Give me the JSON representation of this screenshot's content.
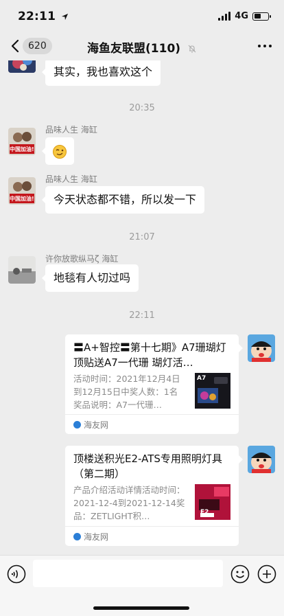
{
  "status": {
    "time": "22:11",
    "network": "4G",
    "battery_level": 0.55
  },
  "header": {
    "unread_count": "620",
    "title": "海鱼友联盟(110)"
  },
  "messages": [
    {
      "text": "其实，我也喜欢这个"
    },
    {
      "time": "20:35"
    },
    {
      "sender": "品味人生 海缸",
      "avatar_text": "中国加油!",
      "sticker": "wink-emoji"
    },
    {
      "sender": "品味人生 海缸",
      "avatar_text": "中国加油!",
      "text": "今天状态都不错，所以发一下"
    },
    {
      "time": "21:07"
    },
    {
      "sender": "许你放歌纵马ζ 海缸",
      "text": "地毯有人切过吗"
    },
    {
      "time": "22:11"
    }
  ],
  "cards": [
    {
      "title": "〓A+智控〓第十七期》A7珊瑚灯顶贴送A7一代珊 瑚灯活…",
      "desc": "活动时间：2021年12月4日到12月15日中奖人数：1名奖品说明：A7一代珊…",
      "thumb_text": "A7",
      "source": "海友网"
    },
    {
      "title": "顶楼送积光E2-ATS专用照明灯具（第二期）",
      "desc": "产品介绍活动详情活动时间：2021-12-4到2021-12-14奖品：ZETLIGHT积…",
      "thumb_text": "E2",
      "source": "海友网"
    }
  ],
  "input": {
    "placeholder": ""
  },
  "colors": {
    "background": "#ededed",
    "bubble": "#ffffff",
    "link_blue": "#2b7fd7"
  }
}
